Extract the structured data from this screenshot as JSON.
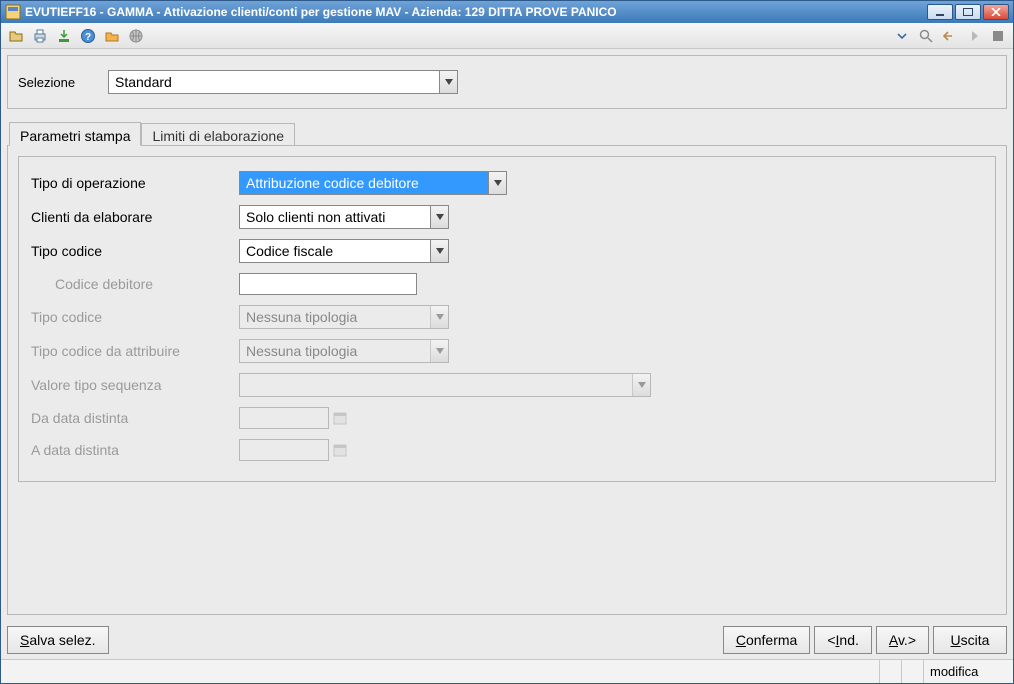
{
  "title": "EVUTIEFF16 - GAMMA - Attivazione clienti/conti per gestione MAV - Azienda: 129 DITTA PROVE PANICO",
  "selection": {
    "label": "Selezione",
    "value": "Standard"
  },
  "tabs": [
    "Parametri stampa",
    "Limiti di elaborazione"
  ],
  "form": {
    "tipo_operazione": {
      "label": "Tipo di operazione",
      "value": "Attribuzione codice debitore"
    },
    "clienti": {
      "label": "Clienti da elaborare",
      "value": "Solo clienti non attivati"
    },
    "tipo_codice": {
      "label": "Tipo codice",
      "value": "Codice fiscale"
    },
    "codice_debitore": {
      "label": "Codice debitore",
      "value": ""
    },
    "tipo_codice2": {
      "label": "Tipo codice",
      "value": "Nessuna tipologia"
    },
    "tipo_codice_attr": {
      "label": "Tipo codice da attribuire",
      "value": "Nessuna tipologia"
    },
    "valore_sequenza": {
      "label": "Valore tipo sequenza",
      "value": ""
    },
    "da_data": {
      "label": "Da data distinta",
      "value": ""
    },
    "a_data": {
      "label": "A data distinta",
      "value": ""
    }
  },
  "buttons": {
    "salva": "Salva selez.",
    "conferma": "Conferma",
    "indietro": "<Ind.",
    "avanti": "Av.>",
    "uscita": "Uscita"
  },
  "status": {
    "mode": "modifica"
  }
}
